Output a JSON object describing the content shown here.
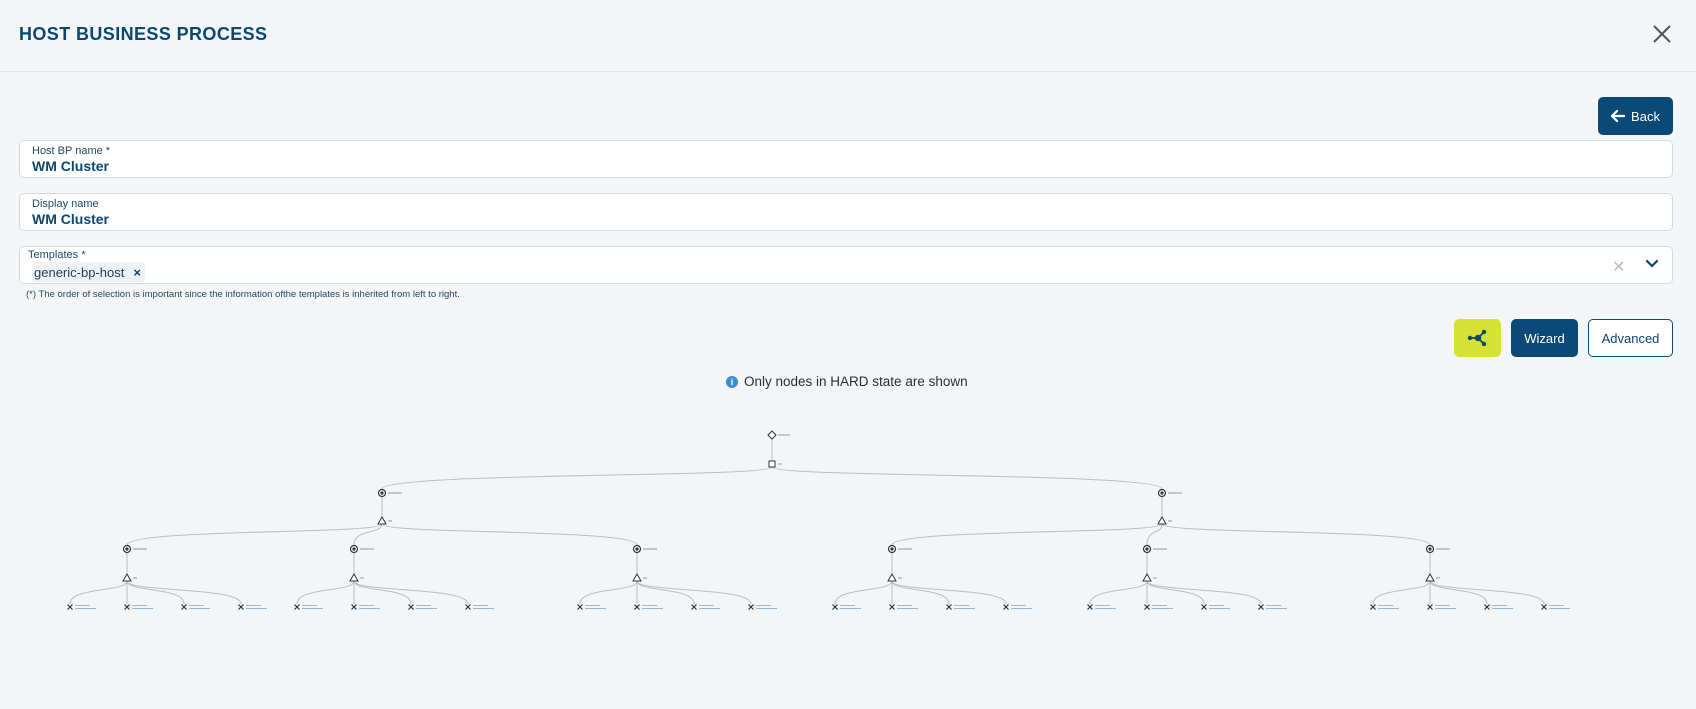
{
  "header": {
    "title": "HOST BUSINESS PROCESS"
  },
  "toolbar": {
    "back_label": "Back",
    "wizard_label": "Wizard",
    "advanced_label": "Advanced"
  },
  "form": {
    "host_bp_name": {
      "label": "Host BP name *",
      "value": "WM Cluster"
    },
    "display_name": {
      "label": "Display name",
      "value": "WM Cluster"
    },
    "templates": {
      "label": "Templates *",
      "chips": [
        "generic-bp-host"
      ]
    },
    "note": "(*) The order of selection is important since the information ofthe templates is inherited from left to right."
  },
  "info": {
    "message": "Only nodes in HARD state are shown"
  },
  "colors": {
    "primary": "#0b4a76",
    "accent_yellow": "#d6e135",
    "info_blue": "#3a8fd3",
    "background": "#f3f5f7"
  },
  "icons": {
    "close": "close-icon",
    "back": "arrow-left-icon",
    "graph": "graph-view-icon",
    "dropdown": "chevron-down-icon",
    "clear": "clear-icon",
    "info": "info-icon"
  }
}
